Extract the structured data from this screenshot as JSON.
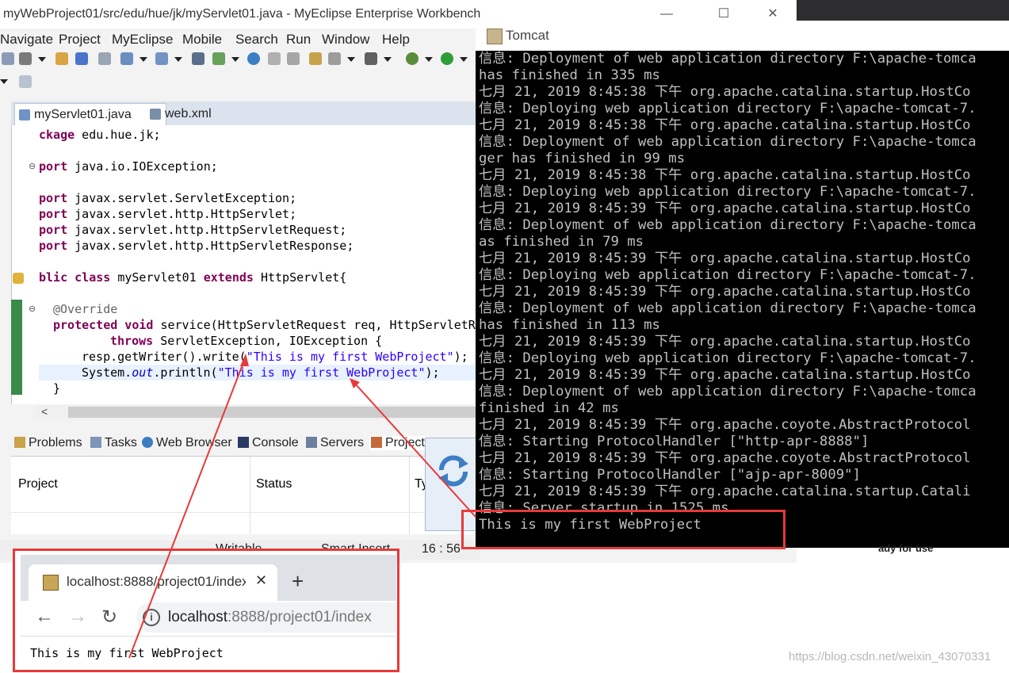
{
  "eclipse": {
    "title": "myWebProject01/src/edu/hue/jk/myServlet01.java - MyEclipse Enterprise Workbench",
    "window_controls": [
      "—",
      "☐",
      "✕"
    ],
    "menu": [
      "Navigate",
      "Project",
      "MyEclipse",
      "Mobile",
      "Search",
      "Run",
      "Window",
      "Help"
    ],
    "editor_tabs": [
      {
        "label": "myServlet01.java",
        "active": true,
        "icon": "java-file-icon"
      },
      {
        "label": "web.xml",
        "active": false,
        "icon": "xml-file-icon"
      }
    ],
    "code": {
      "line1_kw": "ckage",
      "line1_rest": " edu.hue.jk;",
      "import_kw": "port",
      "imports": [
        " java.io.IOException;",
        " javax.servlet.ServletException;",
        " javax.servlet.http.HttpServlet;",
        " javax.servlet.http.HttpServletRequest;",
        " javax.servlet.http.HttpServletResponse;"
      ],
      "class_kw1": "blic class",
      "class_name": " myServlet01 ",
      "class_kw2": "extends",
      "class_rest": " HttpServlet{",
      "annotation": "@Override",
      "method_kw": "protected void",
      "method_rest": " service(HttpServletRequest req, HttpServletRe",
      "throws_kw": "throws",
      "throws_rest": " ServletException, IOException {",
      "write_pre": "resp.getWriter().write(",
      "write_str": "\"This is my first WebProject\"",
      "write_post": ");",
      "println_pre": "System.",
      "println_out": "out",
      "println_mid": ".println(",
      "println_str": "\"This is my first WebProject\"",
      "println_post": ");",
      "close_brace": "}"
    },
    "views_tabs": [
      "Problems",
      "Tasks",
      "Web Browser",
      "Console",
      "Servers",
      "Project"
    ],
    "views_table": {
      "columns": [
        "Project",
        "Status",
        "Ty"
      ]
    },
    "status_bar": {
      "mode": "Writable",
      "insert": "Smart Insert",
      "position": "16 : 56"
    },
    "right_status": "ady for use"
  },
  "tomcat": {
    "title": "Tomcat",
    "lines": [
      "信息: Deployment of web application directory F:\\apache-tomca",
      "has finished in 335 ms",
      "七月 21, 2019 8:45:38 下午 org.apache.catalina.startup.HostCo",
      "信息: Deploying web application directory F:\\apache-tomcat-7.",
      "七月 21, 2019 8:45:38 下午 org.apache.catalina.startup.HostCo",
      "信息: Deployment of web application directory F:\\apache-tomca",
      "ger has finished in 99 ms",
      "七月 21, 2019 8:45:38 下午 org.apache.catalina.startup.HostCo",
      "信息: Deploying web application directory F:\\apache-tomcat-7.",
      "七月 21, 2019 8:45:39 下午 org.apache.catalina.startup.HostCo",
      "信息: Deployment of web application directory F:\\apache-tomca",
      "as finished in 79 ms",
      "七月 21, 2019 8:45:39 下午 org.apache.catalina.startup.HostCo",
      "信息: Deploying web application directory F:\\apache-tomcat-7.",
      "七月 21, 2019 8:45:39 下午 org.apache.catalina.startup.HostCo",
      "信息: Deployment of web application directory F:\\apache-tomca",
      "has finished in 113 ms",
      "七月 21, 2019 8:45:39 下午 org.apache.catalina.startup.HostCo",
      "信息: Deploying web application directory F:\\apache-tomcat-7.",
      "七月 21, 2019 8:45:39 下午 org.apache.catalina.startup.HostCo",
      "信息: Deployment of web application directory F:\\apache-tomca",
      "finished in 42 ms",
      "七月 21, 2019 8:45:39 下午 org.apache.coyote.AbstractProtocol",
      "信息: Starting ProtocolHandler [\"http-apr-8888\"]",
      "七月 21, 2019 8:45:39 下午 org.apache.coyote.AbstractProtocol",
      "信息: Starting ProtocolHandler [\"ajp-apr-8009\"]",
      "七月 21, 2019 8:45:39 下午 org.apache.catalina.startup.Catali",
      "信息: Server startup in 1525 ms",
      "This is my first WebProject"
    ]
  },
  "browser": {
    "tab_title": "localhost:8888/project01/index",
    "url_host": "localhost",
    "url_rest": ":8888/project01/index",
    "page_text": "This is my first WebProject"
  },
  "watermark": "https://blog.csdn.net/weixin_43070331",
  "colors": {
    "highlight_box": "#e8393a",
    "keyword": "#7f0055",
    "string": "#2a00ff"
  }
}
